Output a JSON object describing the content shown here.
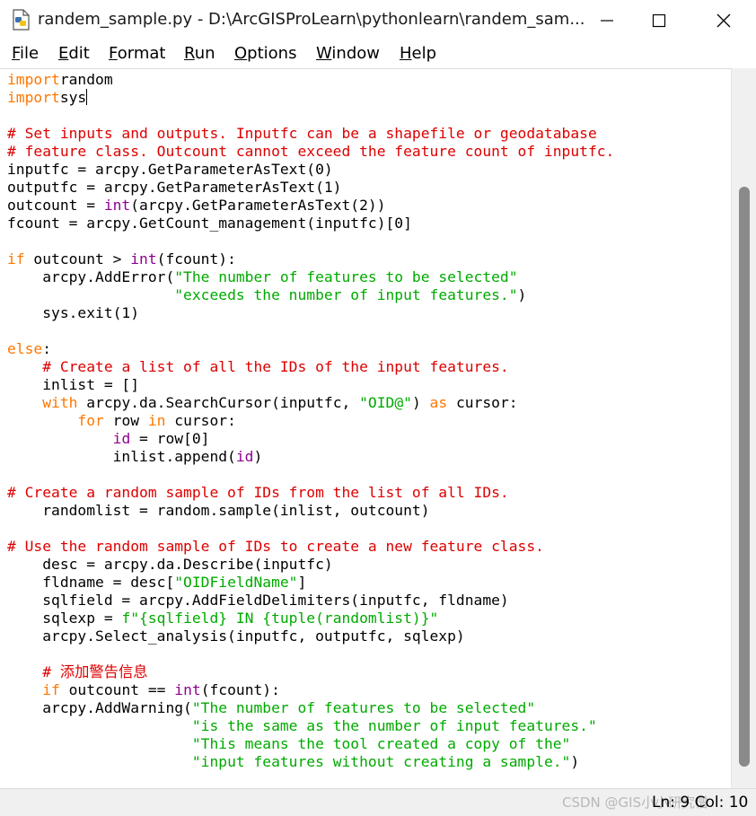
{
  "window": {
    "title": "randem_sample.py - D:\\ArcGISProLearn\\pythonlearn\\randem_sam...",
    "app_icon": "python-file-icon",
    "controls": [
      "minimize-icon",
      "maximize-icon",
      "close-icon"
    ]
  },
  "menu": [
    "File",
    "Edit",
    "Format",
    "Run",
    "Options",
    "Window",
    "Help"
  ],
  "menu_underline": [
    "F",
    "E",
    "F",
    "R",
    "O",
    "W",
    "H"
  ],
  "colors": {
    "keyword": "#ff7700",
    "comment": "#dd0000",
    "string": "#00aa00",
    "builtin": "#900090"
  },
  "code_lines": [
    [
      [
        "kw",
        "import"
      ],
      [
        "",
        "random"
      ]
    ],
    [
      [
        "kw",
        "import"
      ],
      [
        "",
        "sys"
      ]
    ],
    [],
    [
      [
        "cm",
        "# Set inputs and outputs. Inputfc can be a shapefile or geodatabase"
      ]
    ],
    [
      [
        "cm",
        "# feature class. Outcount cannot exceed the feature count of inputfc."
      ]
    ],
    [
      [
        "",
        "inputfc = arcpy.GetParameterAsText(0)"
      ]
    ],
    [
      [
        "",
        "outputfc = arcpy.GetParameterAsText(1)"
      ]
    ],
    [
      [
        "",
        "outcount = "
      ],
      [
        "bi",
        "int"
      ],
      [
        "",
        "(arcpy.GetParameterAsText(2))"
      ]
    ],
    [
      [
        "",
        "fcount = arcpy.GetCount_management(inputfc)[0]"
      ]
    ],
    [],
    [
      [
        "kw",
        "if"
      ],
      [
        "",
        " outcount > "
      ],
      [
        "bi",
        "int"
      ],
      [
        "",
        "(fcount):"
      ]
    ],
    [
      [
        "",
        "    arcpy.AddError("
      ],
      [
        "st",
        "\"The number of features to be selected\""
      ]
    ],
    [
      [
        "",
        "                   "
      ],
      [
        "st",
        "\"exceeds the number of input features.\""
      ],
      [
        "",
        ")"
      ]
    ],
    [
      [
        "",
        "    sys.exit(1)"
      ]
    ],
    [],
    [
      [
        "kw",
        "else"
      ],
      [
        "",
        ":"
      ]
    ],
    [
      [
        "",
        "    "
      ],
      [
        "cm",
        "# Create a list of all the IDs of the input features."
      ]
    ],
    [
      [
        "",
        "    inlist = []"
      ]
    ],
    [
      [
        "",
        "    "
      ],
      [
        "kw",
        "with"
      ],
      [
        "",
        " arcpy.da.SearchCursor(inputfc, "
      ],
      [
        "st",
        "\"OID@\""
      ],
      [
        "",
        ") "
      ],
      [
        "kw",
        "as"
      ],
      [
        "",
        " cursor:"
      ]
    ],
    [
      [
        "",
        "        "
      ],
      [
        "kw",
        "for"
      ],
      [
        "",
        " row "
      ],
      [
        "kw",
        "in"
      ],
      [
        "",
        " cursor:"
      ]
    ],
    [
      [
        "",
        "            "
      ],
      [
        "bi",
        "id"
      ],
      [
        "",
        " = row[0]"
      ]
    ],
    [
      [
        "",
        "            inlist.append("
      ],
      [
        "bi",
        "id"
      ],
      [
        "",
        ")"
      ]
    ],
    [],
    [
      [
        "cm",
        "# Create a random sample of IDs from the list of all IDs."
      ]
    ],
    [
      [
        "",
        "    randomlist = random.sample(inlist, outcount)"
      ]
    ],
    [],
    [
      [
        "cm",
        "# Use the random sample of IDs to create a new feature class."
      ]
    ],
    [
      [
        "",
        "    desc = arcpy.da.Describe(inputfc)"
      ]
    ],
    [
      [
        "",
        "    fldname = desc["
      ],
      [
        "st",
        "\"OIDFieldName\""
      ],
      [
        "",
        "]"
      ]
    ],
    [
      [
        "",
        "    sqlfield = arcpy.AddFieldDelimiters(inputfc, fldname)"
      ]
    ],
    [
      [
        "",
        "    sqlexp = "
      ],
      [
        "st",
        "f\"{sqlfield} IN {tuple(randomlist)}\""
      ]
    ],
    [
      [
        "",
        "    arcpy.Select_analysis(inputfc, outputfc, sqlexp)"
      ]
    ],
    [],
    [
      [
        "",
        "    "
      ],
      [
        "cm",
        "# 添加警告信息"
      ]
    ],
    [
      [
        "",
        "    "
      ],
      [
        "kw",
        "if"
      ],
      [
        "",
        " outcount == "
      ],
      [
        "bi",
        "int"
      ],
      [
        "",
        "(fcount):"
      ]
    ],
    [
      [
        "",
        "    arcpy.AddWarning("
      ],
      [
        "st",
        "\"The number of features to be selected\""
      ]
    ],
    [
      [
        "",
        "                     "
      ],
      [
        "st",
        "\"is the same as the number of input features.\""
      ]
    ],
    [
      [
        "",
        "                     "
      ],
      [
        "st",
        "\"This means the tool created a copy of the\""
      ]
    ],
    [
      [
        "",
        "                     "
      ],
      [
        "st",
        "\"input features without creating a sample.\""
      ],
      [
        "",
        ")"
      ]
    ]
  ],
  "caret": {
    "line": 2,
    "col": 10
  },
  "status": {
    "position": "Ln: 9   Col: 10",
    "watermark": "CSDN @GIS小小研究僧"
  }
}
